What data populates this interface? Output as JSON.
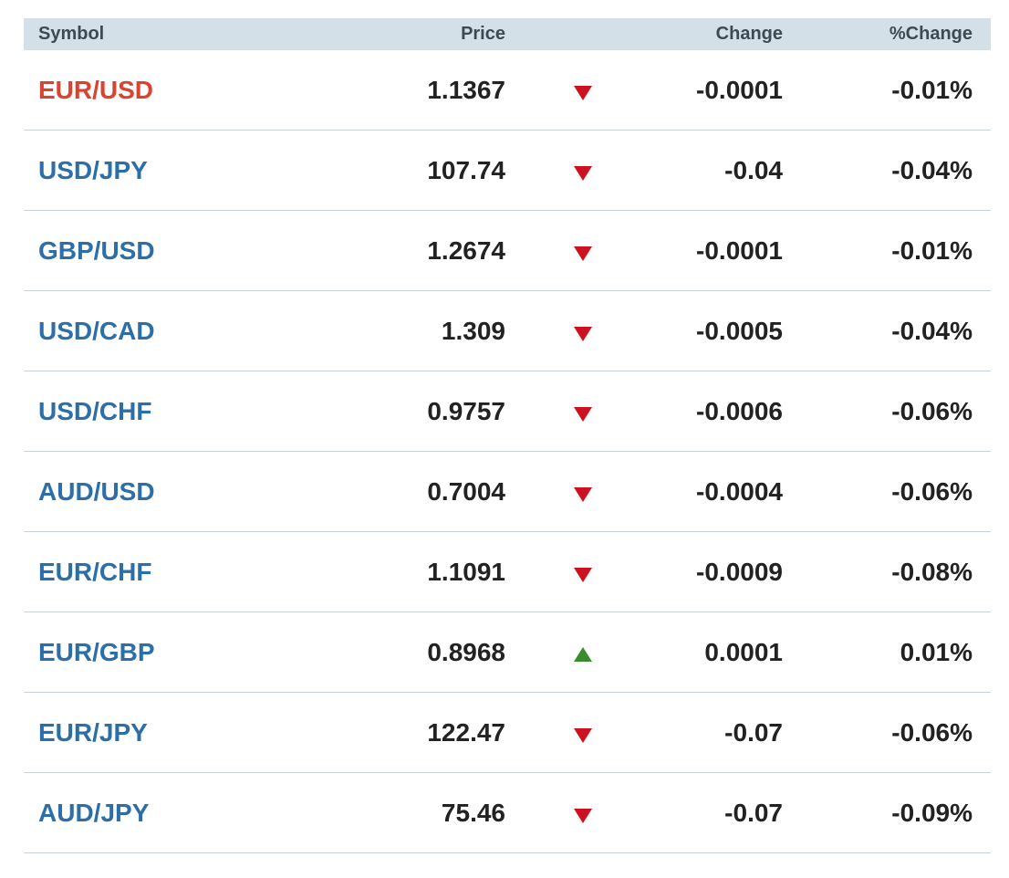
{
  "columns": {
    "symbol": "Symbol",
    "price": "Price",
    "change": "Change",
    "pct_change": "%Change"
  },
  "colors": {
    "header_bg": "#d4e0e8",
    "link": "#2b6ea8",
    "active_link": "#d9432f",
    "down": "#cc1122",
    "up": "#3a8a2e",
    "row_border": "#c7d2da"
  },
  "rows": [
    {
      "symbol": "EUR/USD",
      "price": "1.1367",
      "direction": "down",
      "change": "-0.0001",
      "pct_change": "-0.01%"
    },
    {
      "symbol": "USD/JPY",
      "price": "107.74",
      "direction": "down",
      "change": "-0.04",
      "pct_change": "-0.04%"
    },
    {
      "symbol": "GBP/USD",
      "price": "1.2674",
      "direction": "down",
      "change": "-0.0001",
      "pct_change": "-0.01%"
    },
    {
      "symbol": "USD/CAD",
      "price": "1.309",
      "direction": "down",
      "change": "-0.0005",
      "pct_change": "-0.04%"
    },
    {
      "symbol": "USD/CHF",
      "price": "0.9757",
      "direction": "down",
      "change": "-0.0006",
      "pct_change": "-0.06%"
    },
    {
      "symbol": "AUD/USD",
      "price": "0.7004",
      "direction": "down",
      "change": "-0.0004",
      "pct_change": "-0.06%"
    },
    {
      "symbol": "EUR/CHF",
      "price": "1.1091",
      "direction": "down",
      "change": "-0.0009",
      "pct_change": "-0.08%"
    },
    {
      "symbol": "EUR/GBP",
      "price": "0.8968",
      "direction": "up",
      "change": "0.0001",
      "pct_change": "0.01%"
    },
    {
      "symbol": "EUR/JPY",
      "price": "122.47",
      "direction": "down",
      "change": "-0.07",
      "pct_change": "-0.06%"
    },
    {
      "symbol": "AUD/JPY",
      "price": "75.46",
      "direction": "down",
      "change": "-0.07",
      "pct_change": "-0.09%"
    }
  ]
}
